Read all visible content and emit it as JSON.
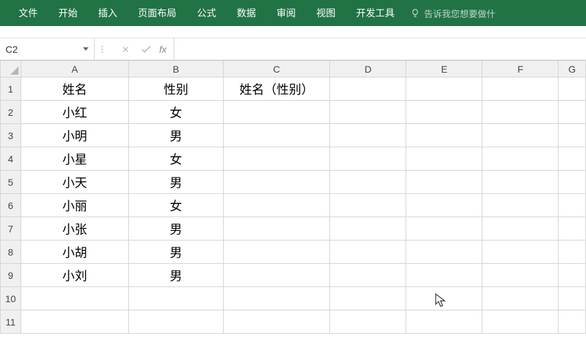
{
  "ribbon": {
    "tabs": [
      "文件",
      "开始",
      "插入",
      "页面布局",
      "公式",
      "数据",
      "审阅",
      "视图",
      "开发工具"
    ],
    "tell_me": "告诉我您想要做什"
  },
  "formula_bar": {
    "name_box": "C2",
    "fx": "fx",
    "input_value": ""
  },
  "columns": [
    "A",
    "B",
    "C",
    "D",
    "E",
    "F",
    "G"
  ],
  "row_count": 11,
  "cells": {
    "r1": {
      "A": "姓名",
      "B": "性别",
      "C": "姓名（性别）"
    },
    "r2": {
      "A": "小红",
      "B": "女"
    },
    "r3": {
      "A": "小明",
      "B": "男"
    },
    "r4": {
      "A": "小星",
      "B": "女"
    },
    "r5": {
      "A": "小天",
      "B": "男"
    },
    "r6": {
      "A": "小丽",
      "B": "女"
    },
    "r7": {
      "A": "小张",
      "B": "男"
    },
    "r8": {
      "A": "小胡",
      "B": "男"
    },
    "r9": {
      "A": "小刘",
      "B": "男"
    }
  }
}
